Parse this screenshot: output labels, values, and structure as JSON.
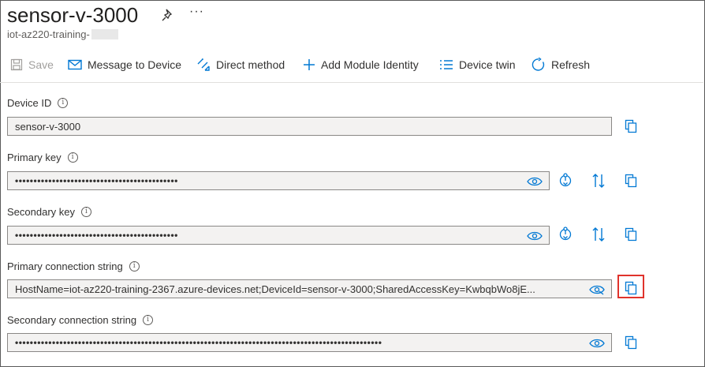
{
  "header": {
    "title": "sensor-v-3000",
    "more_label": "···",
    "subtitle": "iot-az220-training-"
  },
  "toolbar": {
    "save_label": "Save",
    "message_label": "Message to Device",
    "direct_method_label": "Direct method",
    "add_module_label": "Add Module Identity",
    "device_twin_label": "Device twin",
    "refresh_label": "Refresh"
  },
  "fields": {
    "device_id": {
      "label": "Device ID",
      "value": "sensor-v-3000"
    },
    "primary_key": {
      "label": "Primary key",
      "value": "••••••••••••••••••••••••••••••••••••••••••••"
    },
    "secondary_key": {
      "label": "Secondary key",
      "value": "••••••••••••••••••••••••••••••••••••••••••••"
    },
    "primary_conn": {
      "label": "Primary connection string",
      "value": "HostName=iot-az220-training-2367.azure-devices.net;DeviceId=sensor-v-3000;SharedAccessKey=KwbqbWo8jE..."
    },
    "secondary_conn": {
      "label": "Secondary connection string",
      "value": "•••••••••••••••••••••••••••••••••••••••••••••••••••••••••••••••••••••••••••••••••••••••••••••••••••"
    }
  },
  "info_glyph": "i",
  "colors": {
    "accent": "#0078d4",
    "highlight": "#e0332c",
    "field_bg": "#f3f2f1"
  },
  "icons": [
    "pin-icon",
    "save-icon",
    "mail-icon",
    "direct-method-icon",
    "plus-icon",
    "list-icon",
    "refresh-icon",
    "copy-icon",
    "eye-icon",
    "eye-hidden-icon",
    "regenerate-key-icon",
    "swap-icon",
    "info-icon"
  ]
}
